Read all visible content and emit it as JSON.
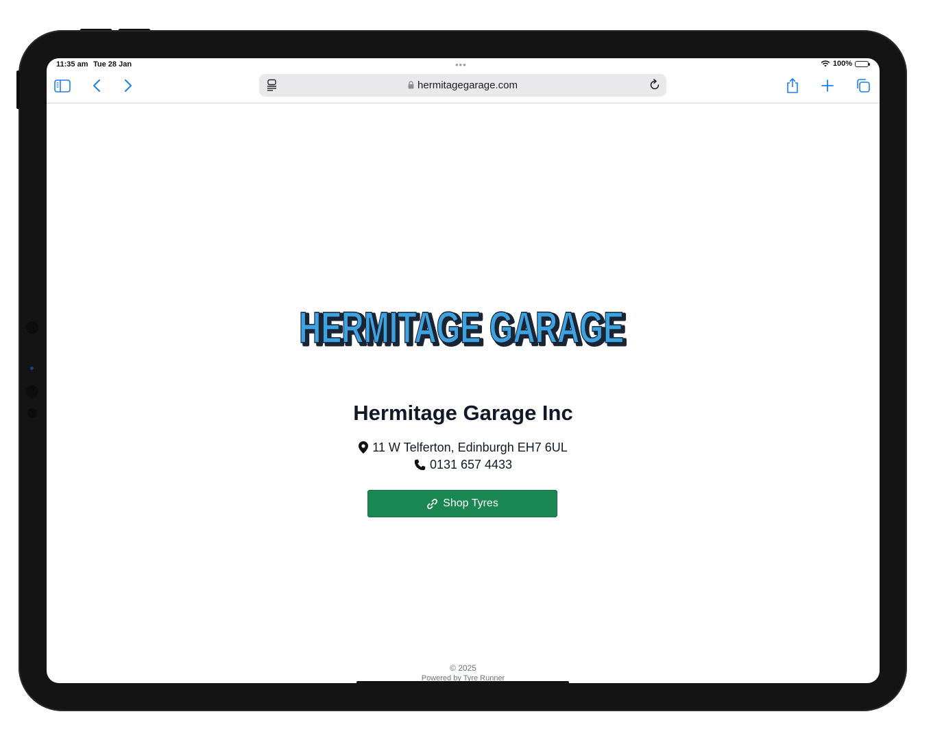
{
  "status": {
    "time": "11:35 am",
    "date": "Tue 28 Jan",
    "battery": "100%"
  },
  "browser": {
    "url": "hermitagegarage.com",
    "icons": [
      "sidebar-icon",
      "back-icon",
      "forward-icon",
      "reader-icon",
      "lock-icon",
      "reload-icon",
      "share-icon",
      "new-tab-icon",
      "tabs-icon"
    ],
    "accent_color": "#1d7cf2"
  },
  "page": {
    "logo_text": "HERMITAGE GARAGE",
    "business_name": "Hermitage Garage Inc",
    "address": "11 W Telferton, Edinburgh EH7 6UL",
    "phone": "0131 657 4433",
    "shop_button_label": "Shop Tyres",
    "button_color": "#1a8652",
    "copyright": "© 2025",
    "powered_by": "Powered by Tyre Runner"
  }
}
